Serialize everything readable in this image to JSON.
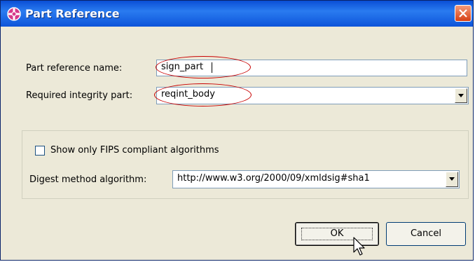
{
  "dialog": {
    "title": "Part Reference",
    "part_reference_name": {
      "label": "Part reference name:",
      "value": "sign_part"
    },
    "required_integrity_part": {
      "label": "Required integrity part:",
      "value": "reqint_body"
    },
    "fips_checkbox": {
      "label": "Show only FIPS compliant algorithms",
      "checked": false
    },
    "digest_method": {
      "label": "Digest method algorithm:",
      "value": "http://www.w3.org/2000/09/xmldsig#sha1"
    },
    "ok_label": "OK",
    "cancel_label": "Cancel"
  },
  "colors": {
    "titlebar": "#0a4fd6",
    "highlight_oval": "#c80000",
    "dialog_bg": "#ece9d8"
  },
  "icons": {
    "app": "part-reference-icon",
    "close": "close-icon",
    "dropdown": "chevron-down-icon",
    "cursor": "mouse-pointer-icon"
  }
}
